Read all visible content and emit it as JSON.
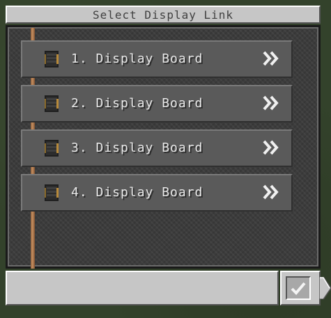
{
  "window": {
    "title": "Select Display Link"
  },
  "entries": [
    {
      "label": "1. Display Board",
      "icon": "display-board-icon",
      "action_icon": "double-chevron-right-icon"
    },
    {
      "label": "2. Display Board",
      "icon": "display-board-icon",
      "action_icon": "double-chevron-right-icon"
    },
    {
      "label": "3. Display Board",
      "icon": "display-board-icon",
      "action_icon": "double-chevron-right-icon"
    },
    {
      "label": "4. Display Board",
      "icon": "display-board-icon",
      "action_icon": "double-chevron-right-icon"
    }
  ],
  "bottom_bar": {
    "input_value": "",
    "confirm_icon": "checkmark-icon"
  },
  "colors": {
    "panel_bg": "#3c3c3c",
    "entry_bg": "#5a5a5a",
    "frame": "#c6c6c6",
    "rope": "#c48e5f",
    "text_light": "#e8e8e8",
    "text_dark": "#404040"
  }
}
